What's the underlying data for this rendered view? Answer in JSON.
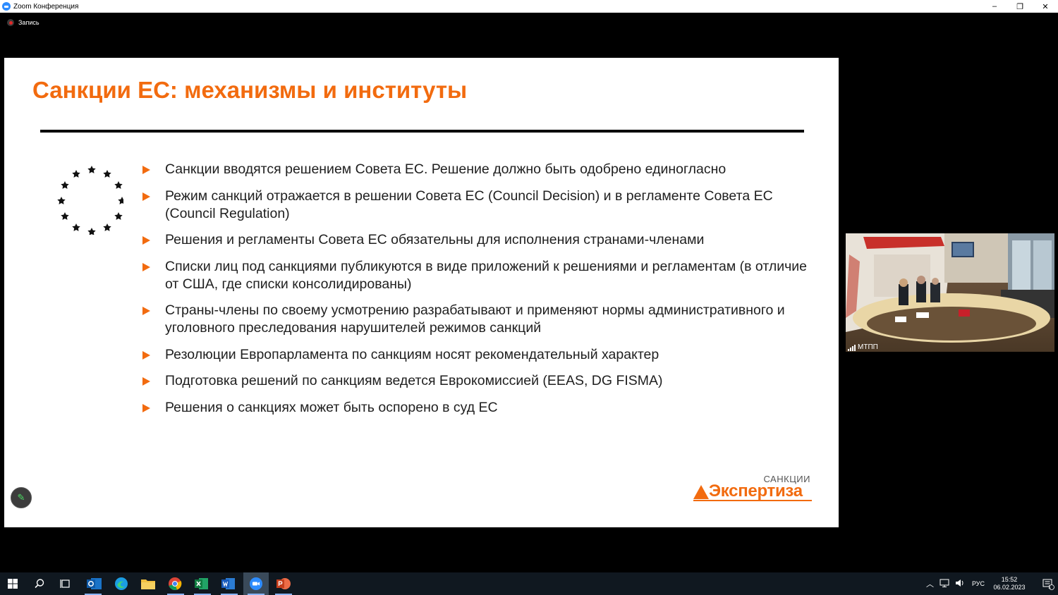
{
  "window": {
    "title": "Zoom Конференция",
    "minimize": "–",
    "restore": "❐",
    "close": "✕"
  },
  "recording": {
    "label": "Запись"
  },
  "slide": {
    "title": "Санкции ЕС: механизмы и институты",
    "bullets": [
      "Санкции вводятся решением Совета ЕС. Решение должно быть одобрено единогласно",
      "Режим санкций отражается в решении Совета ЕС (Council Decision) и в регламенте Совета ЕС (Council Regulation)",
      "Решения и регламенты Совета ЕС обязательны для исполнения странами-членами",
      "Списки лиц под санкциями публикуются в виде приложений к решениями и регламентам (в отличие от США, где списки консолидированы)",
      "Страны-члены по своему усмотрению разрабатывают и применяют нормы административного и уголовного преследования нарушителей режимов санкций",
      "Резолюции Европарламента по санкциям носят рекомендательный характер",
      "Подготовка решений по санкциям ведется Еврокомиссией (EEAS, DG FISMA)",
      "Решения о санкциях может быть оспорено в суд ЕС"
    ],
    "logo": {
      "small": "САНКЦИИ",
      "big": "Экспертиза"
    },
    "accent_color": "#F26B0F"
  },
  "video": {
    "participant_name": "МТПП"
  },
  "taskbar": {
    "apps": [
      "windows-start",
      "search",
      "task-view",
      "outlook",
      "edge",
      "file-explorer",
      "chrome",
      "excel",
      "word",
      "zoom",
      "powerpoint"
    ],
    "language": "РУС",
    "time": "15:52",
    "date": "06.02.2023",
    "notification_count": "1"
  }
}
